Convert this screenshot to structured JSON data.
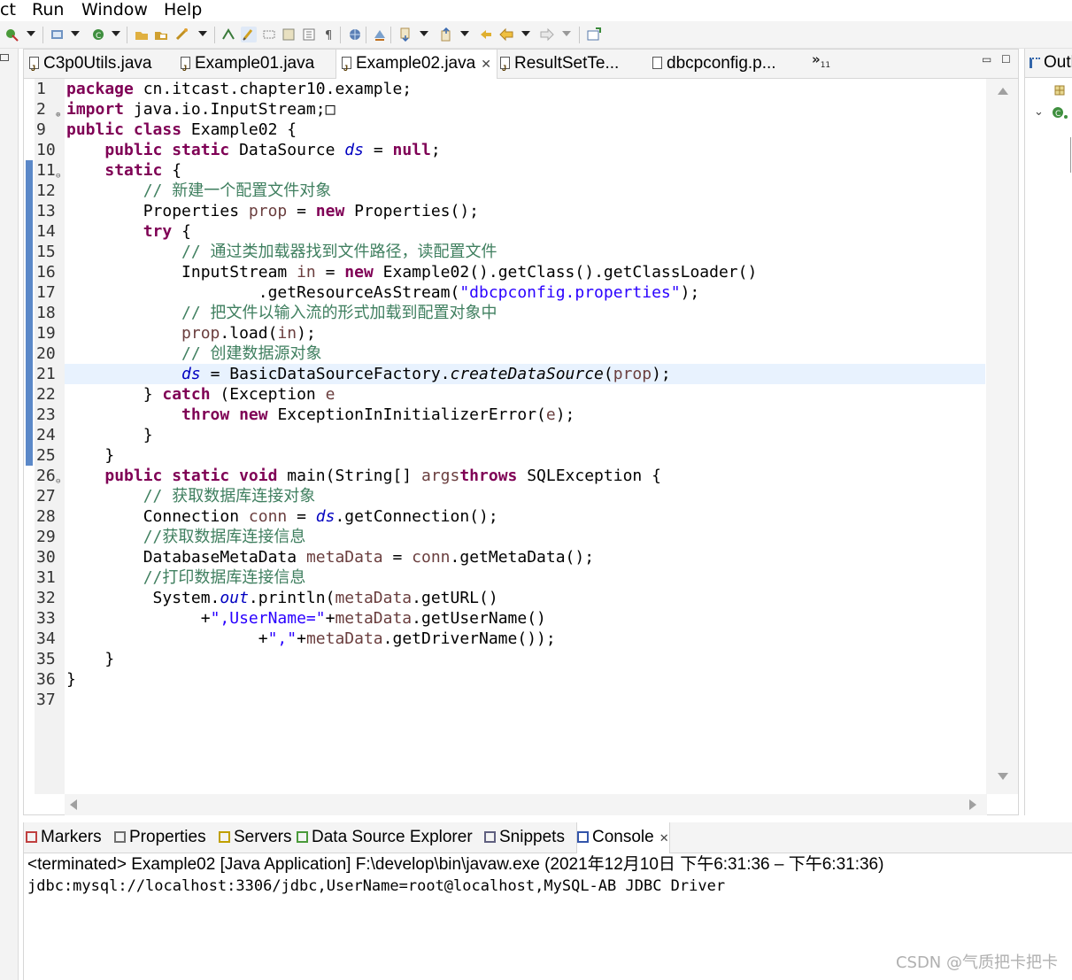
{
  "menu": [
    "ct",
    "Run",
    "Window",
    "Help"
  ],
  "editor_tabs": [
    {
      "label": "C3p0Utils.java"
    },
    {
      "label": "Example01.java"
    },
    {
      "label": "Example02.java",
      "active": true,
      "close": "✕"
    },
    {
      "label": "ResultSetTe..."
    },
    {
      "label": "dbcpconfig.p..."
    }
  ],
  "tab_overflow": {
    "chevron": "»",
    "count": "11"
  },
  "outline_tab": "Outline",
  "code_lines": [
    {
      "n": "1",
      "tokens": [
        [
          "kw",
          "package"
        ],
        [
          "",
          "cn.itcast.chapter10.example;"
        ]
      ]
    },
    {
      "n": "2",
      "fold": "+",
      "tokens": [
        [
          "kw",
          "import"
        ],
        [
          "",
          "java.io.InputStream;"
        ],
        [
          "",
          "□"
        ]
      ]
    },
    {
      "n": "9",
      "tokens": [
        [
          "kw",
          "public"
        ],
        [
          "kw",
          "class"
        ],
        [
          "",
          "Example02 {"
        ]
      ]
    },
    {
      "n": "10",
      "tokens": [
        [
          "",
          "    "
        ],
        [
          "kw",
          "public"
        ],
        [
          "kw",
          "static"
        ],
        [
          "",
          "DataSource "
        ],
        [
          "fld",
          "ds"
        ],
        [
          "",
          " = "
        ],
        [
          "kw",
          "null"
        ],
        [
          "",
          ";"
        ]
      ]
    },
    {
      "n": "11",
      "fold": "−",
      "tokens": [
        [
          "",
          "    "
        ],
        [
          "kw",
          "static"
        ],
        [
          "",
          "{"
        ]
      ]
    },
    {
      "n": "12",
      "tokens": [
        [
          "",
          "        "
        ],
        [
          "cm",
          "// 新建一个配置文件对象"
        ]
      ]
    },
    {
      "n": "13",
      "tokens": [
        [
          "",
          "        Properties "
        ],
        [
          "loc",
          "prop"
        ],
        [
          "",
          " = "
        ],
        [
          "kw",
          "new"
        ],
        [
          "",
          "Properties();"
        ]
      ]
    },
    {
      "n": "14",
      "tokens": [
        [
          "",
          "        "
        ],
        [
          "kw",
          "try"
        ],
        [
          "",
          "{"
        ]
      ]
    },
    {
      "n": "15",
      "tokens": [
        [
          "",
          "            "
        ],
        [
          "cm",
          "// 通过类加载器找到文件路径，读配置文件"
        ]
      ]
    },
    {
      "n": "16",
      "tokens": [
        [
          "",
          "            InputStream "
        ],
        [
          "loc",
          "in"
        ],
        [
          "",
          " = "
        ],
        [
          "kw",
          "new"
        ],
        [
          "",
          "Example02().getClass().getClassLoader()"
        ]
      ]
    },
    {
      "n": "17",
      "tokens": [
        [
          "",
          "                    .getResourceAsStream("
        ],
        [
          "str",
          "\"dbcpconfig.properties\""
        ],
        [
          "",
          ");"
        ]
      ]
    },
    {
      "n": "18",
      "tokens": [
        [
          "",
          "            "
        ],
        [
          "cm",
          "// 把文件以输入流的形式加载到配置对象中"
        ]
      ]
    },
    {
      "n": "19",
      "tokens": [
        [
          "",
          "            "
        ],
        [
          "loc",
          "prop"
        ],
        [
          "",
          ".load("
        ],
        [
          "loc",
          "in"
        ],
        [
          "",
          ");"
        ]
      ]
    },
    {
      "n": "20",
      "tokens": [
        [
          "",
          "            "
        ],
        [
          "cm",
          "// 创建数据源对象"
        ]
      ]
    },
    {
      "n": "21",
      "hl": true,
      "tokens": [
        [
          "",
          "            "
        ],
        [
          "fld",
          "ds"
        ],
        [
          "",
          " = BasicDataSourceFactory."
        ],
        [
          "its",
          "createDataSource"
        ],
        [
          "",
          "("
        ],
        [
          "loc",
          "prop"
        ],
        [
          "",
          ");"
        ]
      ]
    },
    {
      "n": "22",
      "tokens": [
        [
          "",
          "        } "
        ],
        [
          "kw",
          "catch"
        ],
        [
          "",
          " (Exception "
        ],
        [
          "loc",
          "e"
        ],
        [
          ") {"
        ]
      ]
    },
    {
      "n": "23",
      "tokens": [
        [
          "",
          "            "
        ],
        [
          "kw",
          "throw"
        ],
        [
          "kw",
          "new"
        ],
        [
          "",
          "ExceptionInInitializerError("
        ],
        [
          "loc",
          "e"
        ],
        [
          "",
          ");"
        ]
      ]
    },
    {
      "n": "24",
      "tokens": [
        [
          "",
          "        }"
        ]
      ]
    },
    {
      "n": "25",
      "tokens": [
        [
          "",
          "    }"
        ]
      ]
    },
    {
      "n": "26",
      "fold": "−",
      "tokens": [
        [
          "",
          "    "
        ],
        [
          "kw",
          "public"
        ],
        [
          "kw",
          "static"
        ],
        [
          "kw",
          "void"
        ],
        [
          "",
          "main(String[] "
        ],
        [
          "loc",
          "args"
        ],
        [
          ") "
        ],
        [
          "kw",
          "throws"
        ],
        [
          "",
          "SQLException {"
        ]
      ]
    },
    {
      "n": "27",
      "tokens": [
        [
          "",
          "        "
        ],
        [
          "cm",
          "// 获取数据库连接对象"
        ]
      ]
    },
    {
      "n": "28",
      "tokens": [
        [
          "",
          "        Connection "
        ],
        [
          "loc",
          "conn"
        ],
        [
          "",
          " = "
        ],
        [
          "fld",
          "ds"
        ],
        [
          "",
          ".getConnection();"
        ]
      ]
    },
    {
      "n": "29",
      "tokens": [
        [
          "",
          "        "
        ],
        [
          "cm",
          "//获取数据库连接信息"
        ]
      ]
    },
    {
      "n": "30",
      "tokens": [
        [
          "",
          "        DatabaseMetaData "
        ],
        [
          "loc",
          "metaData"
        ],
        [
          "",
          " = "
        ],
        [
          "loc",
          "conn"
        ],
        [
          "",
          ".getMetaData();"
        ]
      ]
    },
    {
      "n": "31",
      "tokens": [
        [
          "",
          "        "
        ],
        [
          "cm",
          "//打印数据库连接信息"
        ]
      ]
    },
    {
      "n": "32",
      "tokens": [
        [
          "",
          "         System."
        ],
        [
          "fld",
          "out"
        ],
        [
          "",
          ".println("
        ],
        [
          "loc",
          "metaData"
        ],
        [
          "",
          ".getURL()"
        ]
      ]
    },
    {
      "n": "33",
      "tokens": [
        [
          "",
          "              +"
        ],
        [
          "str",
          "\",UserName=\""
        ],
        [
          "",
          "+"
        ],
        [
          "loc",
          "metaData"
        ],
        [
          "",
          ".getUserName()"
        ]
      ]
    },
    {
      "n": "34",
      "tokens": [
        [
          "",
          "                    +"
        ],
        [
          "str",
          "\",\""
        ],
        [
          "",
          "+"
        ],
        [
          "loc",
          "metaData"
        ],
        [
          "",
          ".getDriverName());"
        ]
      ]
    },
    {
      "n": "35",
      "tokens": [
        [
          "",
          "    }"
        ]
      ]
    },
    {
      "n": "36",
      "tokens": [
        [
          "",
          "}"
        ]
      ]
    },
    {
      "n": "37",
      "tokens": []
    }
  ],
  "bottom_tabs": [
    {
      "label": "Markers",
      "color": "#c04040"
    },
    {
      "label": "Properties",
      "color": "#707070"
    },
    {
      "label": "Servers",
      "color": "#c0a000"
    },
    {
      "label": "Data Source Explorer",
      "color": "#4a9a3a"
    },
    {
      "label": "Snippets",
      "color": "#606080"
    },
    {
      "label": "Console",
      "color": "#3355aa",
      "active": true,
      "close": "✕"
    }
  ],
  "console": {
    "header": "<terminated> Example02 [Java Application] F:\\develop\\bin\\javaw.exe  (2021年12月10日 下午6:31:36 – 下午6:31:36)",
    "output": "jdbc:mysql://localhost:3306/jdbc,UserName=root@localhost,MySQL-AB JDBC Driver"
  },
  "watermark": "CSDN @气质把卡把卡",
  "colors": {
    "keyword": "#7f0055",
    "string": "#2a00ff",
    "comment": "#3f7f5f",
    "field": "#0000c0",
    "local": "#6a3e3e",
    "highlight": "#e8f2fe",
    "change_ruler": "#5b88c8"
  }
}
